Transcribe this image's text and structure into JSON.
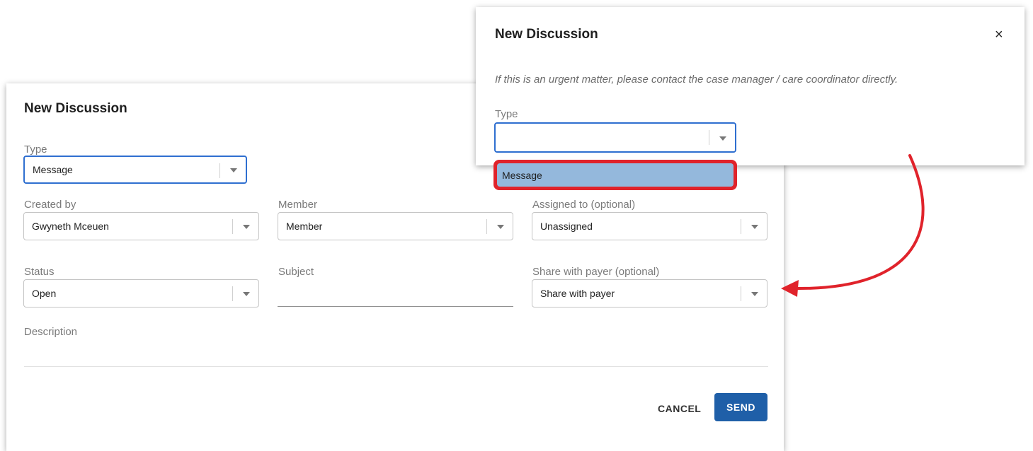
{
  "back_dialog": {
    "title": "New Discussion",
    "type": {
      "label": "Type",
      "value": "Message"
    },
    "created_by": {
      "label": "Created by",
      "value": "Gwyneth Mceuen"
    },
    "member": {
      "label": "Member",
      "value": "Member"
    },
    "assigned_to": {
      "label": "Assigned to (optional)",
      "value": "Unassigned"
    },
    "status": {
      "label": "Status",
      "value": "Open"
    },
    "subject": {
      "label": "Subject",
      "value": ""
    },
    "share_with_payer": {
      "label": "Share with payer (optional)",
      "value": "Share with payer"
    },
    "description": {
      "label": "Description"
    },
    "buttons": {
      "cancel": "CANCEL",
      "send": "SEND"
    }
  },
  "front_dialog": {
    "title": "New Discussion",
    "close": "×",
    "note": "If this is an urgent matter, please contact the case manager / care coordinator directly.",
    "type": {
      "label": "Type",
      "value": ""
    },
    "dropdown_options": [
      "Message"
    ]
  },
  "colors": {
    "accent": "#1f5fa8",
    "focus_border": "#2f6fd0",
    "highlight": "#e0232b",
    "option_selected": "#94b8dc"
  },
  "icons": {
    "close": "close-icon",
    "dropdown": "chevron-down-icon",
    "annotation_arrow": "curved-arrow-icon"
  }
}
